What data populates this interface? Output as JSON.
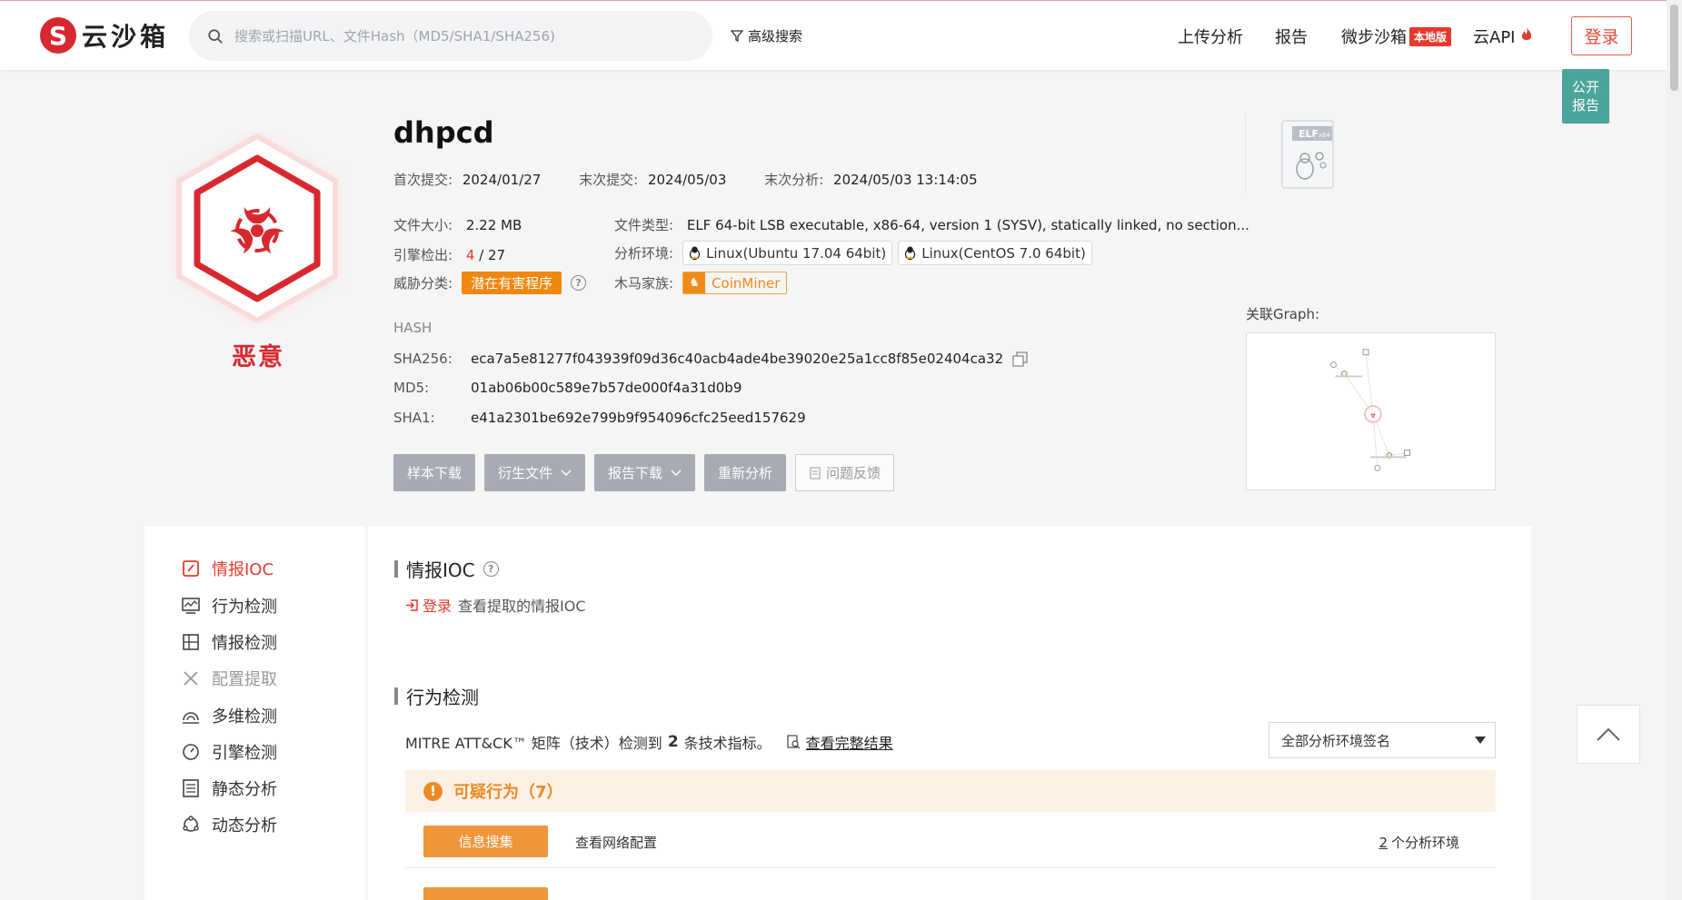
{
  "header": {
    "logo_char": "S",
    "logo_text": "云沙箱",
    "search_placeholder": "搜索或扫描URL、文件Hash（MD5/SHA1/SHA256)",
    "advanced_search": "高级搜索",
    "nav": {
      "upload": "上传分析",
      "report": "报告",
      "sandbox": "微步沙箱",
      "local_badge": "本地版",
      "cloud_api": "云API",
      "login": "登录"
    }
  },
  "public_report": [
    "公开",
    "报告"
  ],
  "summary": {
    "verdict": "恶意",
    "file_name": "dhpcd",
    "first_submit_label": "首次提交:",
    "first_submit": "2024/01/27",
    "last_submit_label": "末次提交:",
    "last_submit": "2024/05/03",
    "last_analysis_label": "末次分析:",
    "last_analysis": "2024/05/03 13:14:05",
    "file_size_label": "文件大小:",
    "file_size": "2.22 MB",
    "file_type_label": "文件类型:",
    "file_type": "ELF 64-bit LSB executable, x86-64, version 1 (SYSV), statically linked, no section...",
    "engine_label": "引擎检出:",
    "engine_detect": "4",
    "engine_total": "/ 27",
    "env_label": "分析环境:",
    "envs": [
      "Linux(Ubuntu 17.04 64bit)",
      "Linux(CentOS 7.0 64bit)"
    ],
    "threat_label": "威胁分类:",
    "threat_tag": "潜在有害程序",
    "family_label": "木马家族:",
    "family": "CoinMiner",
    "hash_title": "HASH",
    "sha256_label": "SHA256:",
    "sha256": "eca7a5e81277f043939f09d36c40acb4ade4be39020e25a1cc8f85e02404ca32",
    "md5_label": "MD5:",
    "md5": "01ab06b00c589e7b57de000f4a31d0b9",
    "sha1_label": "SHA1:",
    "sha1": "e41a2301be692e799b9f954096cfc25eed157629",
    "graph_label": "关联Graph:",
    "elf_label": "ELF",
    "elf_sub": "x64"
  },
  "actions": {
    "download_sample": "样本下载",
    "derived_files": "衍生文件",
    "report_download": "报告下载",
    "reanalyze": "重新分析",
    "feedback": "问题反馈"
  },
  "sidebar": {
    "items": [
      {
        "label": "情报IOC"
      },
      {
        "label": "行为检测"
      },
      {
        "label": "情报检测"
      },
      {
        "label": "配置提取"
      },
      {
        "label": "多维检测"
      },
      {
        "label": "引擎检测"
      },
      {
        "label": "静态分析"
      },
      {
        "label": "动态分析"
      }
    ]
  },
  "ioc": {
    "title": "情报IOC",
    "login_link": "登录",
    "login_text": "查看提取的情报IOC"
  },
  "behavior": {
    "title": "行为检测",
    "mitre_prefix": "MITRE ATT&CK™ 矩阵（技术）检测到",
    "mitre_count": "2",
    "mitre_suffix": "条技术指标。",
    "full_result": "查看完整结果",
    "env_select": "全部分析环境签名",
    "suspicious_title": "可疑行为（7）",
    "rows": [
      {
        "tag": "信息搜集",
        "desc": "查看网络配置",
        "env_count": "2",
        "env_suffix": "个分析环境"
      }
    ]
  },
  "colors": {
    "brand_red": "#d8282f",
    "accent_orange": "#f0870f",
    "teal": "#4aa59a"
  }
}
